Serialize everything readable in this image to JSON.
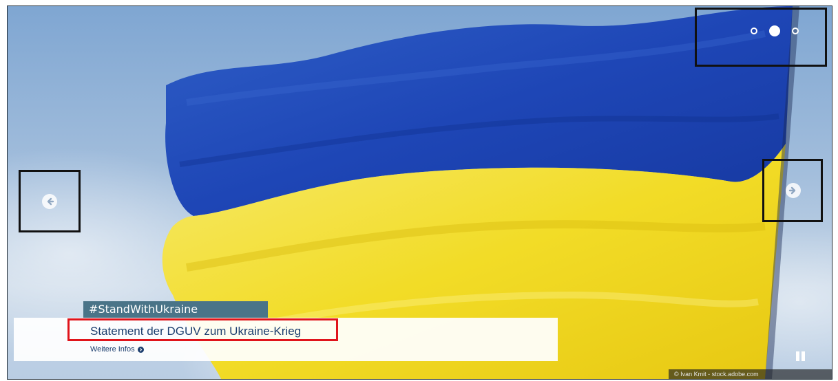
{
  "slider": {
    "tag": "#StandWithUkraine",
    "headline": "Statement der DGUV zum Ukraine-Krieg",
    "more_label": "Weitere Infos",
    "credit": "© Ivan Kmit - stock.adobe.com",
    "dots": 3,
    "active_dot": 2
  },
  "colors": {
    "flag_blue": "#1f49b8",
    "flag_yellow": "#f1dc2a",
    "headline_highlight": "#e0141b",
    "tag_bg": "#4a7488",
    "link_text": "#1c3e6e"
  },
  "icons": {
    "prev": "arrow-left-circle-icon",
    "next": "arrow-right-circle-icon",
    "more": "arrow-right-circle-icon",
    "pause": "pause-icon"
  }
}
